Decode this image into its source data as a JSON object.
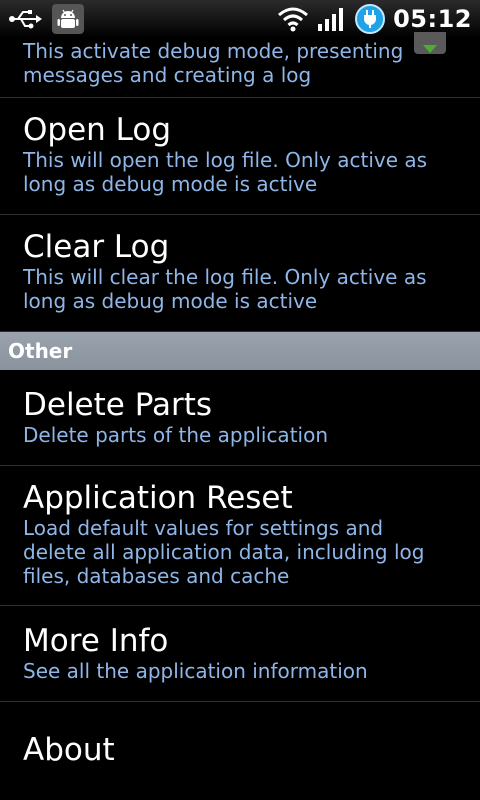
{
  "statusbar": {
    "time": "05:12",
    "icons": [
      "usb-icon",
      "android-debug-icon",
      "wifi-icon",
      "signal-icon",
      "battery-charging-icon"
    ]
  },
  "items": {
    "debug": {
      "summary": "This activate debug mode, presenting messages and creating a log",
      "checkbox": "checked"
    },
    "open_log": {
      "title": "Open Log",
      "summary": "This will open the log file. Only active as long as debug mode is active"
    },
    "clear_log": {
      "title": "Clear Log",
      "summary": "This will clear the log file. Only active as long as debug mode is active"
    },
    "delete_parts": {
      "title": "Delete Parts",
      "summary": "Delete parts of the application"
    },
    "app_reset": {
      "title": "Application Reset",
      "summary": "Load default values for settings and delete all application data, including log files, databases and cache"
    },
    "more_info": {
      "title": "More Info",
      "summary": "See all the application information"
    },
    "about": {
      "title": "About"
    }
  },
  "sections": {
    "other": "Other"
  },
  "colors": {
    "summary_text": "#8fb6e8",
    "section_header_bg": "#939ca6",
    "checkbox_green": "#4caf30",
    "battery_blue": "#1fa3e6"
  }
}
